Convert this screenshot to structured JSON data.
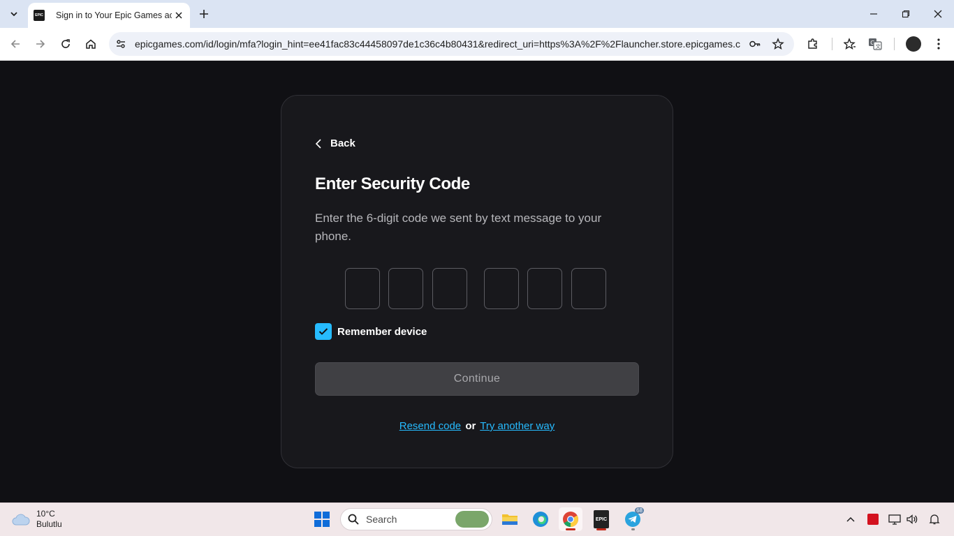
{
  "browser": {
    "tab_title": "Sign in to Your Epic Games acco",
    "favicon_text": "EPIC",
    "url": "epicgames.com/id/login/mfa?login_hint=ee41fac83c44458097de1c36c4b80431&redirect_uri=https%3A%2F%2Flauncher.store.epicgames.c..."
  },
  "page": {
    "back_label": "Back",
    "heading": "Enter Security Code",
    "description": "Enter the 6-digit code we sent by text message to your phone.",
    "code_digits": [
      "",
      "",
      "",
      "",
      "",
      ""
    ],
    "remember_label": "Remember device",
    "remember_checked": true,
    "continue_label": "Continue",
    "resend_label": "Resend code",
    "or_label": "or",
    "try_another_label": "Try another way"
  },
  "taskbar": {
    "weather_temp": "10°C",
    "weather_desc": "Bulutlu",
    "search_label": "Search",
    "telegram_badge": "68",
    "epic_text": "EPIC"
  },
  "colors": {
    "accent": "#26bbff",
    "page_bg": "#101014",
    "card_bg": "#18181c"
  }
}
